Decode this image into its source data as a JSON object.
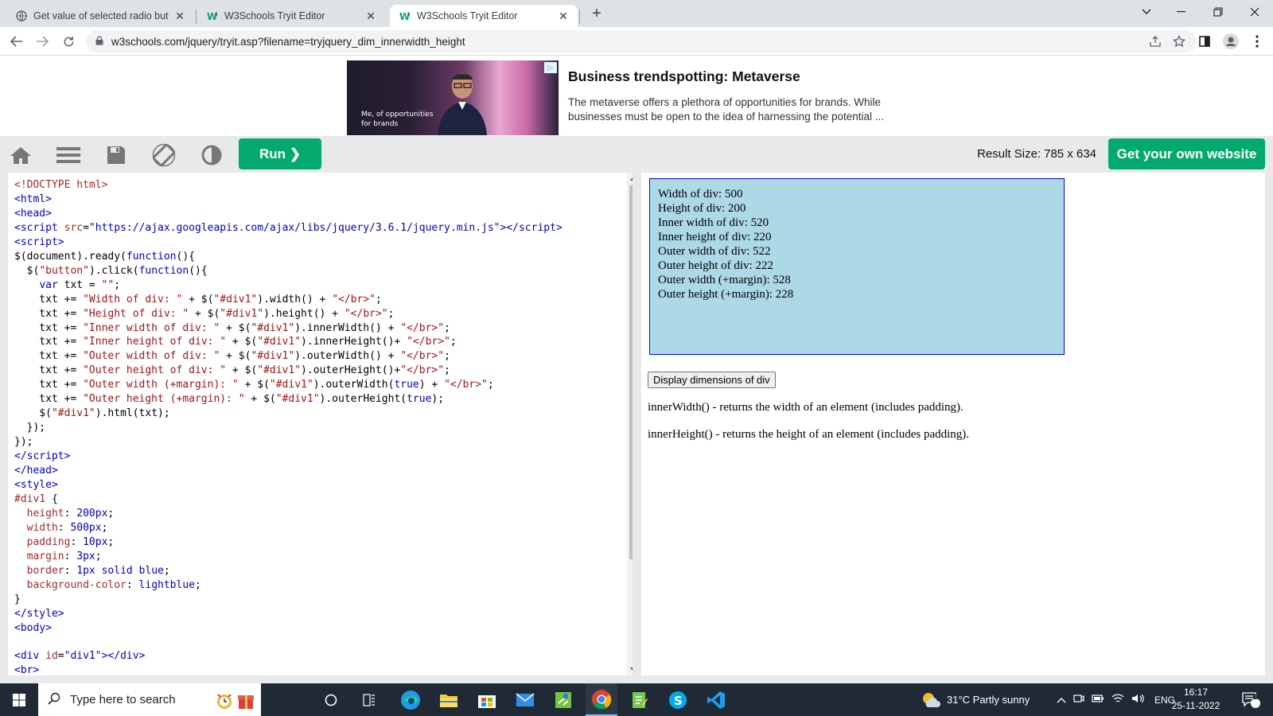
{
  "browser": {
    "tabs": [
      {
        "title": "Get value of selected radio butto",
        "close": "✕"
      },
      {
        "title": "W3Schools Tryit Editor",
        "close": "✕"
      },
      {
        "title": "W3Schools Tryit Editor",
        "close": "✕"
      }
    ],
    "new_tab": "+",
    "url": "w3schools.com/jquery/tryit.asp?filename=tryjquery_dim_innerwidth_height"
  },
  "ad": {
    "title": "Business trendspotting: Metaverse",
    "description": "The metaverse offers a plethora of opportunities for brands. While businesses must be open to the idea of harnessing the potential ...",
    "thumb_caption_1": "Me, of opportunities",
    "thumb_caption_2": "for brands"
  },
  "w3": {
    "run_label": "Run ❯",
    "result_size_label": "Result Size:",
    "result_size_value": "785 x 634",
    "get_website_label": "Get your own website"
  },
  "result": {
    "div_lines": [
      "Width of div: 500",
      "Height of div: 200",
      "Inner width of div: 520",
      "Inner height of div: 220",
      "Outer width of div: 522",
      "Outer height of div: 222",
      "Outer width (+margin): 528",
      "Outer height (+margin): 228"
    ],
    "button_label": "Display dimensions of div",
    "para1": "innerWidth() - returns the width of an element (includes padding).",
    "para2": "innerHeight() - returns the height of an element (includes padding)."
  },
  "taskbar": {
    "search_placeholder": "Type here to search",
    "weather": "31°C  Partly sunny",
    "language": "ENG",
    "time": "16:17",
    "date": "25-11-2022",
    "notification_count": "16"
  },
  "colors": {
    "run_green": "#04aa6d",
    "div_background": "lightblue",
    "div_border": "blue",
    "taskbar": "#202a36"
  }
}
